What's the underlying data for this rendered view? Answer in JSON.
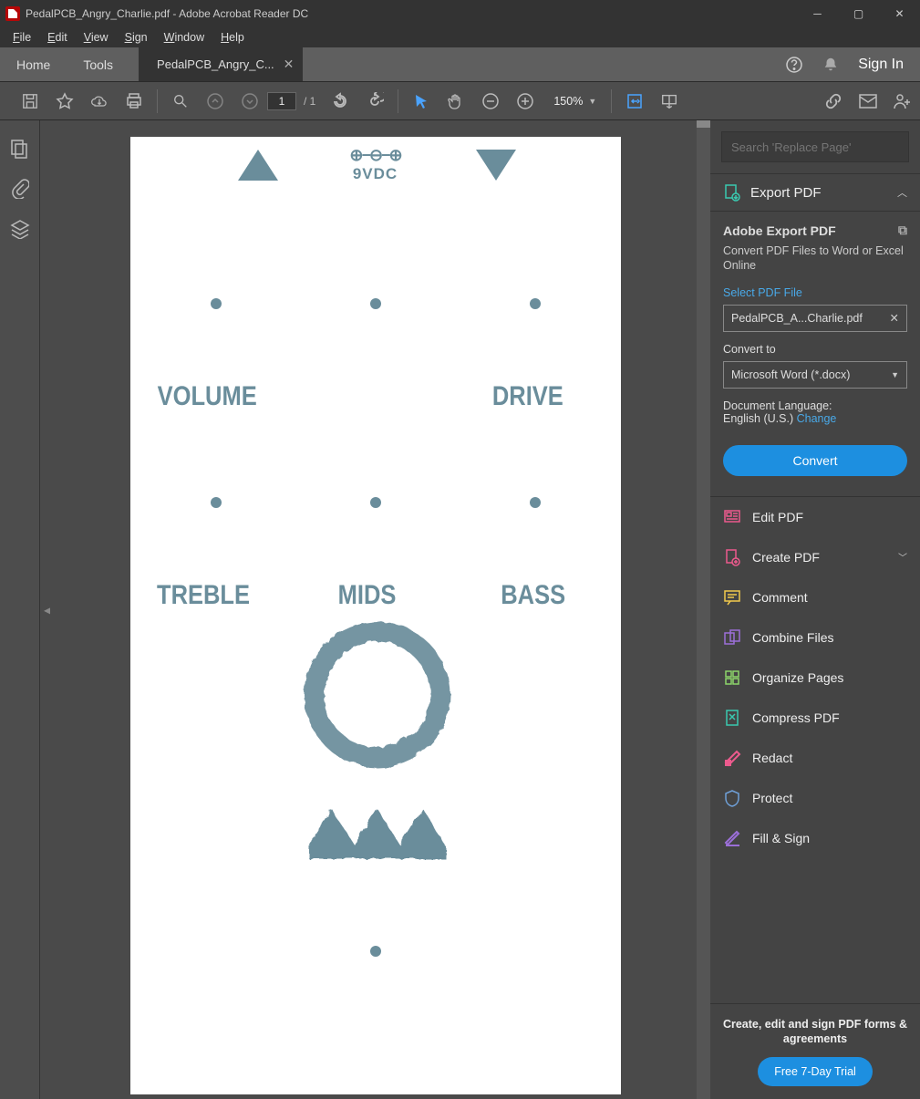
{
  "titlebar": {
    "title": "PedalPCB_Angry_Charlie.pdf - Adobe Acrobat Reader DC"
  },
  "menu": {
    "file": "File",
    "edit": "Edit",
    "view": "View",
    "sign": "Sign",
    "window": "Window",
    "help": "Help"
  },
  "tabs": {
    "home": "Home",
    "tools": "Tools",
    "doc": "PedalPCB_Angry_C...",
    "signin": "Sign In"
  },
  "toolbar": {
    "page": "1",
    "page_total": "/ 1",
    "zoom": "150%"
  },
  "search": {
    "placeholder": "Search 'Replace Page'"
  },
  "export_panel": {
    "header": "Export PDF",
    "title": "Adobe Export PDF",
    "sub": "Convert PDF Files to Word or Excel Online",
    "select_label": "Select PDF File",
    "filename": "PedalPCB_A...Charlie.pdf",
    "convert_to": "Convert to",
    "format": "Microsoft Word (*.docx)",
    "lang_label": "Document Language:",
    "lang": "English (U.S.) ",
    "change": "Change",
    "button": "Convert"
  },
  "tools": {
    "edit": "Edit PDF",
    "create": "Create PDF",
    "comment": "Comment",
    "combine": "Combine Files",
    "organize": "Organize Pages",
    "compress": "Compress PDF",
    "redact": "Redact",
    "protect": "Protect",
    "fillsign": "Fill & Sign"
  },
  "promo": {
    "text": "Create, edit and sign PDF forms & agreements",
    "button": "Free 7-Day Trial"
  },
  "pedal": {
    "power": "9VDC",
    "labels": {
      "volume": "VOLUME",
      "drive": "DRIVE",
      "treble": "TREBLE",
      "mids": "MIDS",
      "bass": "BASS"
    }
  }
}
